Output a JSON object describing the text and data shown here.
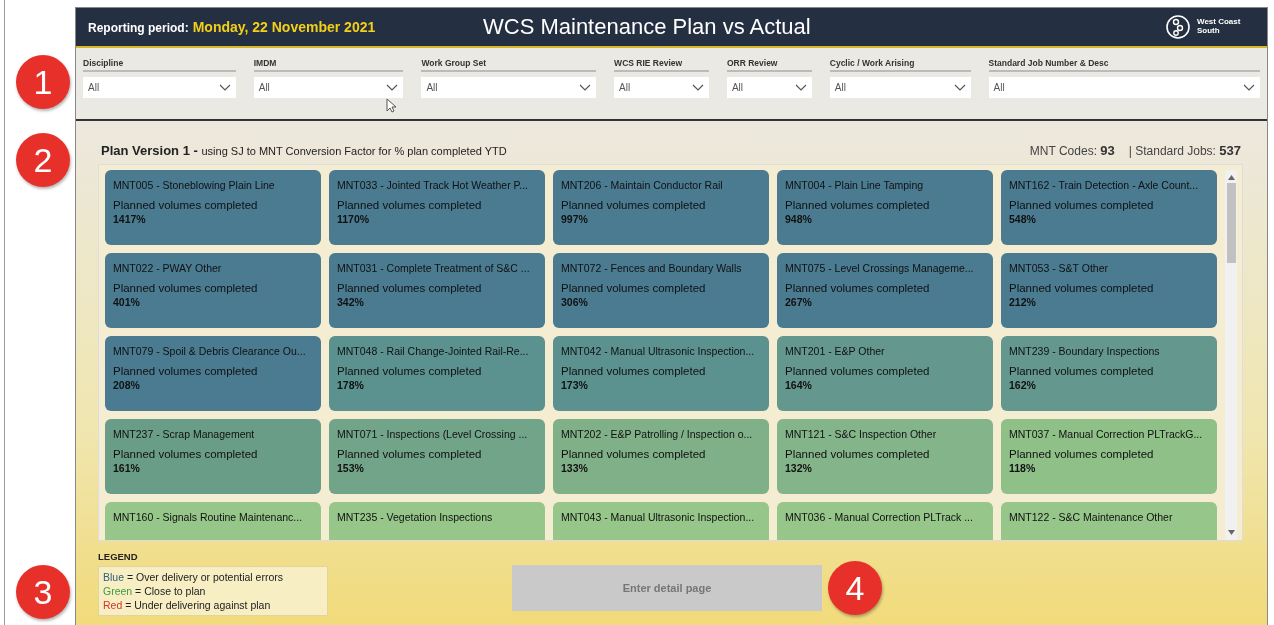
{
  "header": {
    "period_label": "Reporting period:",
    "period_value": "Monday, 22 November 2021",
    "title": "WCS Maintenance Plan vs Actual",
    "logo_text": "West Coast South"
  },
  "annotations": [
    "1",
    "2",
    "3",
    "4"
  ],
  "filters": [
    {
      "label": "Discipline",
      "value": "All"
    },
    {
      "label": "IMDM",
      "value": "All"
    },
    {
      "label": "Work Group Set",
      "value": "All"
    },
    {
      "label": "WCS RIE Review",
      "value": "All"
    },
    {
      "label": "ORR Review",
      "value": "All"
    },
    {
      "label": "Cyclic / Work Arising",
      "value": "All"
    },
    {
      "label": "Standard Job Number & Desc",
      "value": "All"
    }
  ],
  "plan": {
    "title": "Plan Version 1 -",
    "subtitle": "using SJ to MNT Conversion Factor for % plan completed YTD",
    "mnt_label": "MNT Codes:",
    "mnt_value": "93",
    "sj_label": "| Standard Jobs:",
    "sj_value": "537"
  },
  "tiles": [
    {
      "title": "MNT005 - Stoneblowing Plain Line",
      "label": "Planned volumes completed",
      "value": "1417%",
      "color": "#4a7b91"
    },
    {
      "title": "MNT033 - Jointed Track Hot Weather P...",
      "label": "Planned volumes completed",
      "value": "1170%",
      "color": "#4a7b91"
    },
    {
      "title": "MNT206 - Maintain Conductor Rail",
      "label": "Planned volumes completed",
      "value": "997%",
      "color": "#4a7b91"
    },
    {
      "title": "MNT004 - Plain Line Tamping",
      "label": "Planned volumes completed",
      "value": "948%",
      "color": "#4a7b91"
    },
    {
      "title": "MNT162 - Train Detection - Axle Count...",
      "label": "Planned volumes completed",
      "value": "548%",
      "color": "#4a7b91"
    },
    {
      "title": "MNT022 - PWAY Other",
      "label": "Planned volumes completed",
      "value": "401%",
      "color": "#4a7b91"
    },
    {
      "title": "MNT031 - Complete Treatment of S&C ...",
      "label": "Planned volumes completed",
      "value": "342%",
      "color": "#4a7b91"
    },
    {
      "title": "MNT072 - Fences and Boundary Walls",
      "label": "Planned volumes completed",
      "value": "306%",
      "color": "#4a7b91"
    },
    {
      "title": "MNT075 - Level Crossings Manageme...",
      "label": "Planned volumes completed",
      "value": "267%",
      "color": "#4a7b91"
    },
    {
      "title": "MNT053 - S&T Other",
      "label": "Planned volumes completed",
      "value": "212%",
      "color": "#4a7b91"
    },
    {
      "title": "MNT079 - Spoil & Debris Clearance Ou...",
      "label": "Planned volumes completed",
      "value": "208%",
      "color": "#4a7b91"
    },
    {
      "title": "MNT048 - Rail Change-Jointed Rail-Re...",
      "label": "Planned volumes completed",
      "value": "178%",
      "color": "#5b918f"
    },
    {
      "title": "MNT042 - Manual Ultrasonic Inspection...",
      "label": "Planned volumes completed",
      "value": "173%",
      "color": "#5b918f"
    },
    {
      "title": "MNT201 - E&P Other",
      "label": "Planned volumes completed",
      "value": "164%",
      "color": "#64988e"
    },
    {
      "title": "MNT239 - Boundary Inspections",
      "label": "Planned volumes completed",
      "value": "162%",
      "color": "#64988e"
    },
    {
      "title": "MNT237 - Scrap Management",
      "label": "Planned volumes completed",
      "value": "161%",
      "color": "#6a9d88"
    },
    {
      "title": "MNT071 - Inspections (Level Crossing ...",
      "label": "Planned volumes completed",
      "value": "153%",
      "color": "#72a48a"
    },
    {
      "title": "MNT202 - E&P Patrolling / Inspection o...",
      "label": "Planned volumes completed",
      "value": "133%",
      "color": "#80b088"
    },
    {
      "title": "MNT121 - S&C Inspection Other",
      "label": "Planned volumes completed",
      "value": "132%",
      "color": "#84b48a"
    },
    {
      "title": "MNT037 - Manual Correction PLTrackG...",
      "label": "Planned volumes completed",
      "value": "118%",
      "color": "#8ec088"
    },
    {
      "title": "MNT160 - Signals Routine Maintenanc...",
      "color": "#96c689"
    },
    {
      "title": "MNT235 - Vegetation Inspections",
      "color": "#96c689"
    },
    {
      "title": "MNT043 - Manual Ultrasonic Inspection...",
      "color": "#96c689"
    },
    {
      "title": "MNT036 - Manual Correction PLTrack ...",
      "color": "#96c689"
    },
    {
      "title": "MNT122 - S&C Maintenance Other",
      "color": "#96c689"
    }
  ],
  "legend": {
    "title": "LEGEND",
    "items": [
      {
        "word": "Blue",
        "text": "= Over delivery or potential errors",
        "color": "#2e5f7a"
      },
      {
        "word": "Green",
        "text": "= Close to plan",
        "color": "#3f9a3f"
      },
      {
        "word": "Red",
        "text": "= Under delivering against plan",
        "color": "#d9322b"
      }
    ]
  },
  "detail_button": {
    "label": "Enter detail page",
    "disabled": true
  }
}
